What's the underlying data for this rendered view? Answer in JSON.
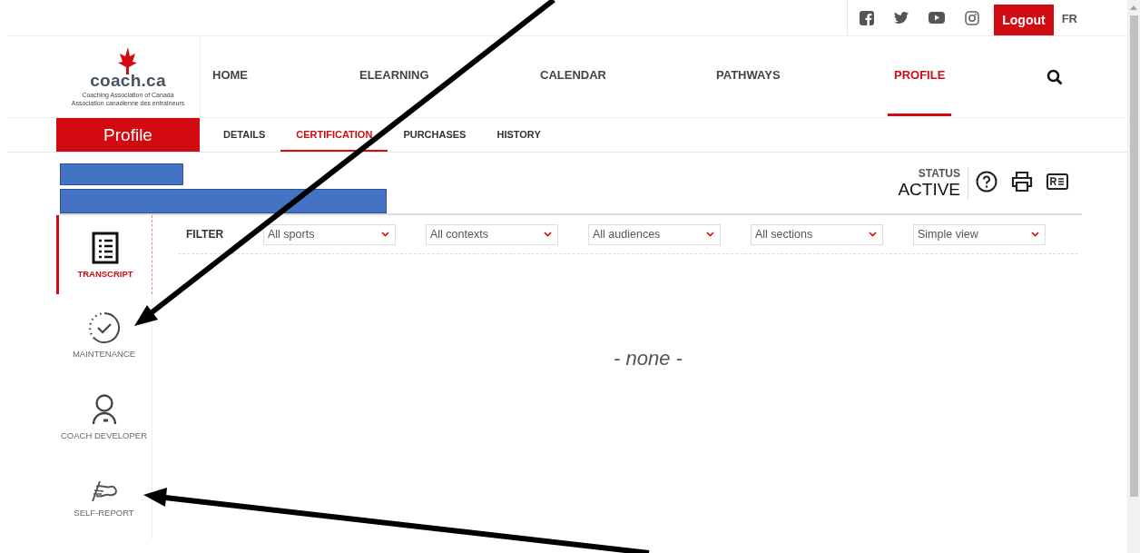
{
  "top_bar": {
    "social": [
      {
        "kind": "facebook"
      },
      {
        "kind": "twitter"
      },
      {
        "kind": "youtube"
      },
      {
        "kind": "instagram"
      }
    ],
    "logout": "Logout",
    "language": "FR"
  },
  "logo": {
    "wordmark": "coach.ca",
    "line_1": "Coaching Association of Canada",
    "line_2": "Association canadienne des entraîneurs"
  },
  "nav": [
    {
      "label": "HOME",
      "selected": false
    },
    {
      "label": "ELEARNING",
      "selected": false
    },
    {
      "label": "CALENDAR",
      "selected": false
    },
    {
      "label": "PATHWAYS",
      "selected": false
    },
    {
      "label": "PROFILE",
      "selected": true
    }
  ],
  "section_title": "Profile",
  "tabs": [
    {
      "label": "DETAILS",
      "selected": false
    },
    {
      "label": "CERTIFICATION",
      "selected": true
    },
    {
      "label": "PURCHASES",
      "selected": false
    },
    {
      "label": "HISTORY",
      "selected": false
    }
  ],
  "redactions": [
    {
      "kind": "short"
    },
    {
      "kind": "long"
    }
  ],
  "status": {
    "label": "STATUS",
    "value": "ACTIVE",
    "actions": [
      {
        "kind": "help"
      },
      {
        "kind": "print"
      },
      {
        "kind": "id-card"
      }
    ]
  },
  "sidebar": [
    {
      "label": "TRANSCRIPT",
      "kind": "transcript",
      "selected": true
    },
    {
      "label": "MAINTENANCE",
      "kind": "maintenance",
      "selected": false
    },
    {
      "label": "COACH DEVELOPER",
      "kind": "coach",
      "selected": false
    },
    {
      "label": "SELF-REPORT",
      "kind": "self-report",
      "selected": false
    }
  ],
  "filter": {
    "label": "FILTER",
    "selects": [
      {
        "value": "All sports"
      },
      {
        "value": "All contexts"
      },
      {
        "value": "All audiences"
      },
      {
        "value": "All sections"
      },
      {
        "value": "Simple view"
      }
    ]
  },
  "empty_text": "- none -",
  "annotations": [
    {
      "kind": "arrow"
    },
    {
      "kind": "arrow"
    }
  ]
}
